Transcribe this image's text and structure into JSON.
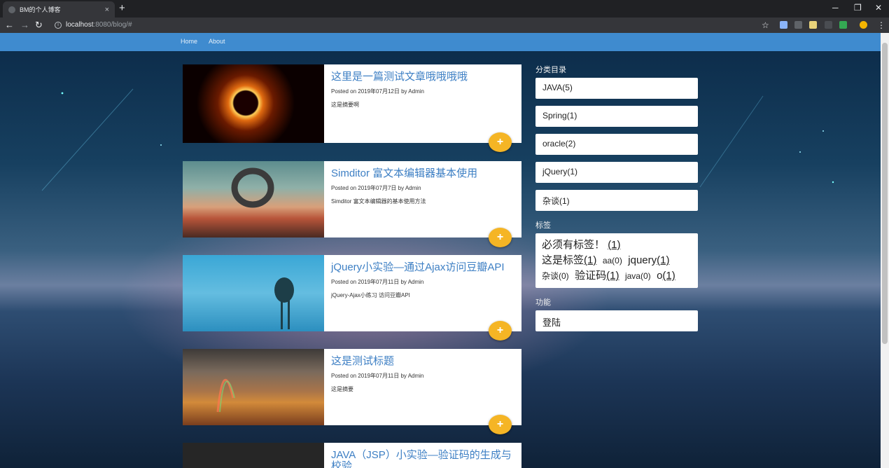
{
  "browser": {
    "tab_title": "BM的个人博客",
    "tab_close": "×",
    "new_tab": "+",
    "url_host": "localhost",
    "url_path": ":8080/blog/#",
    "back": "←",
    "forward": "→",
    "reload": "↻",
    "star": "☆",
    "minimize": "─",
    "restore": "❐",
    "close": "✕",
    "menu": "⋮"
  },
  "navbar": {
    "home": "Home",
    "about": "About"
  },
  "posts": [
    {
      "title": "这里是一篇测试文章哦哦哦哦",
      "meta": "Posted on 2019年07月12日 by Admin",
      "excerpt": "这是摘要啊"
    },
    {
      "title": "Simditor 富文本编辑器基本使用",
      "meta": "Posted on 2019年07月7日 by Admin",
      "excerpt": "Simditor 富文本编辑器的基本使用方法"
    },
    {
      "title": "jQuery小实验—通过Ajax访问豆瓣API",
      "meta": "Posted on 2019年07月11日 by Admin",
      "excerpt": "jQuery-Ajax小练习 访问豆瓣API"
    },
    {
      "title": "这是测试标题",
      "meta": "Posted on 2019年07月11日 by Admin",
      "excerpt": "这是摘要"
    },
    {
      "title": "JAVA（JSP）小实验—验证码的生成与校验",
      "meta": "",
      "excerpt": ""
    }
  ],
  "fab_label": "+",
  "sidebar": {
    "categories_heading": "分类目录",
    "categories": [
      "JAVA(5)",
      "Spring(1)",
      "oracle(2)",
      "jQuery(1)",
      "杂谈(1)"
    ],
    "tags_heading": "标签",
    "tags": [
      {
        "name": "必须有标签！",
        "count": "(1)"
      },
      {
        "name": "这是标签",
        "count": "(1)"
      },
      {
        "name": "aa(0)",
        "count": ""
      },
      {
        "name": "jquery",
        "count": "(1)"
      },
      {
        "name": "杂谈(0)",
        "count": ""
      },
      {
        "name": "验证码",
        "count": "(1)"
      },
      {
        "name": "java(0)",
        "count": ""
      },
      {
        "name": "o",
        "count": "(1)"
      }
    ],
    "functions_heading": "功能",
    "login": "登陆"
  },
  "colors": {
    "navbar": "#3f8bcf",
    "title_link": "#3d7fc4",
    "fab": "#f5b525"
  }
}
